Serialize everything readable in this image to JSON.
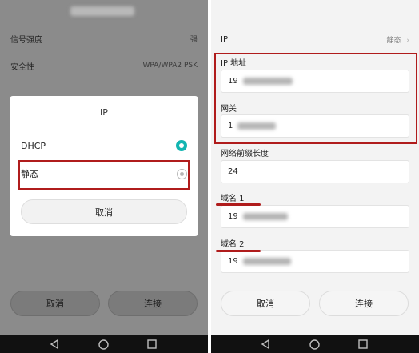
{
  "left_screen": {
    "settings": {
      "signal_label": "信号强度",
      "signal_value": "强",
      "security_label": "安全性",
      "security_value": "WPA/WPA2 PSK"
    },
    "dialog": {
      "title": "IP",
      "options": [
        {
          "label": "DHCP",
          "selected": true
        },
        {
          "label": "静态",
          "selected": false
        }
      ],
      "cancel_label": "取消"
    },
    "buttons": {
      "cancel": "取消",
      "connect": "连接"
    }
  },
  "right_screen": {
    "ip_row": {
      "label": "IP",
      "value": "静态"
    },
    "fields": {
      "ip_address": {
        "label": "IP 地址",
        "value": "19"
      },
      "gateway": {
        "label": "网关",
        "value": "1"
      },
      "prefix_length": {
        "label": "网络前缀长度",
        "value": "24"
      },
      "dns1": {
        "label": "域名 1",
        "value": "19"
      },
      "dns2": {
        "label": "域名 2",
        "value": "19"
      }
    },
    "buttons": {
      "cancel": "取消",
      "connect": "连接"
    }
  },
  "navbar_icons": [
    "back-icon",
    "home-icon",
    "recents-icon"
  ],
  "colors": {
    "accent": "#13b5b1",
    "highlight": "#b01c1c"
  }
}
